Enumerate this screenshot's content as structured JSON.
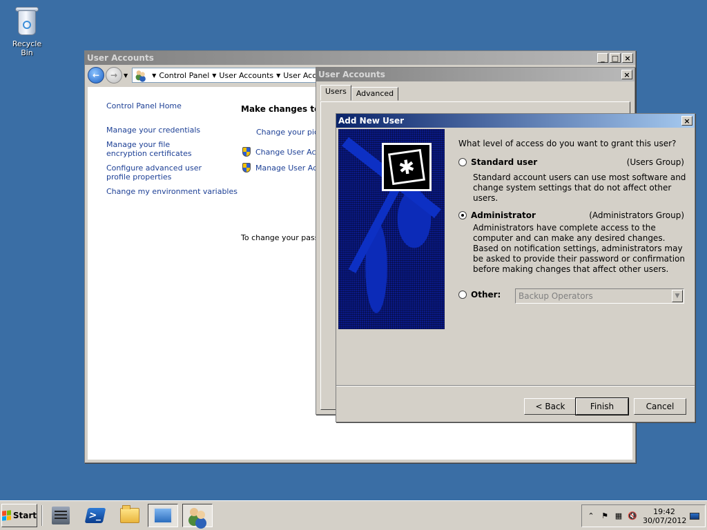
{
  "desktop": {
    "recycle_bin_label": "Recycle Bin"
  },
  "main_window": {
    "title": "User Accounts",
    "address": {
      "crumbs": [
        "Control Panel",
        "User Accounts",
        "User Accou"
      ]
    },
    "sidebar_links": [
      "Control Panel Home",
      "Manage your credentials",
      "Manage your file encryption certificates",
      "Configure advanced user profile properties",
      "Change my environment variables"
    ],
    "heading": "Make changes to yo",
    "tasks": [
      "Change your pictu",
      "Change User Acco",
      "Manage User Acco"
    ],
    "password_text": "To change your passw"
  },
  "props_window": {
    "title": "User Accounts",
    "tabs": [
      "Users",
      "Advanced"
    ]
  },
  "add_user_dialog": {
    "title": "Add New User",
    "question": "What level of access do you want to grant this user?",
    "options": {
      "standard": {
        "label": "Standard user",
        "group": "(Users Group)",
        "description": "Standard account users can use most software and change system settings that do not affect other users.",
        "selected": false
      },
      "administrator": {
        "label": "Administrator",
        "group": "(Administrators Group)",
        "description": "Administrators have complete access to the computer and can make any desired changes. Based on notification settings, administrators may be asked to provide their password or confirmation before making changes that affect other users.",
        "selected": true
      },
      "other": {
        "label": "Other:",
        "combo_value": "Backup Operators",
        "selected": false
      }
    },
    "buttons": {
      "back": "< Back",
      "finish": "Finish",
      "cancel": "Cancel"
    }
  },
  "taskbar": {
    "start_label": "Start",
    "clock": {
      "time": "19:42",
      "date": "30/07/2012"
    }
  }
}
